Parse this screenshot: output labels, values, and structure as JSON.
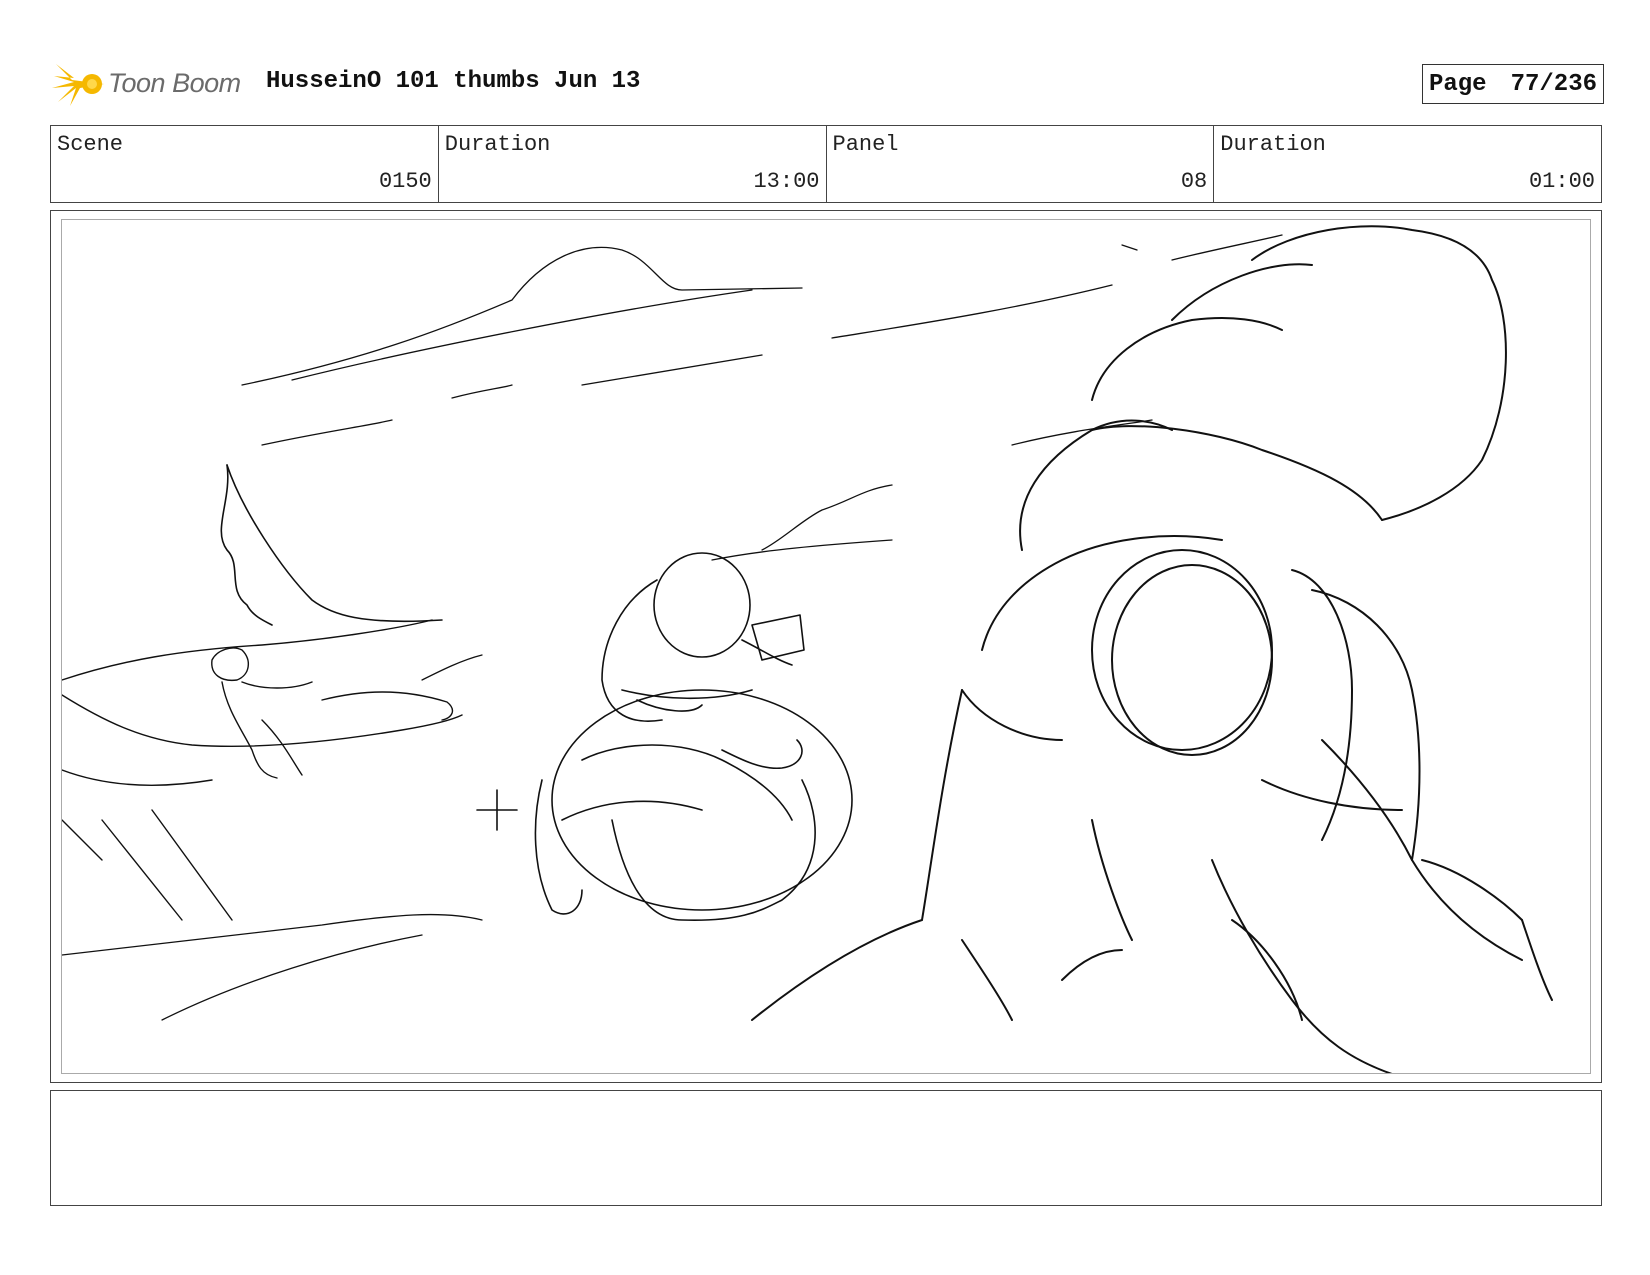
{
  "header": {
    "logo_text": "Toon Boom",
    "title": "HusseinO 101 thumbs Jun 13",
    "page_label": "Page",
    "page_value": "77/236"
  },
  "info": {
    "scene_label": "Scene",
    "scene_value": "0150",
    "duration_label": "Duration",
    "duration_value": "13:00",
    "panel_label": "Panel",
    "panel_value": "08",
    "panel_duration_label": "Duration",
    "panel_duration_value": "01:00"
  },
  "notes": {
    "text": ""
  },
  "colors": {
    "logo_accent": "#f5b800",
    "border": "#444444",
    "sketch": "#111111"
  }
}
